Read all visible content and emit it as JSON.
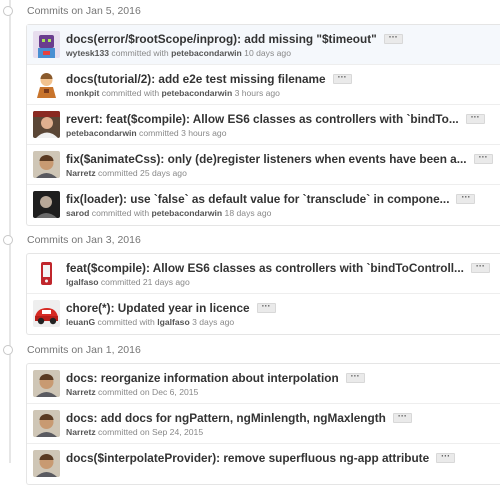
{
  "groups": [
    {
      "date": "Commits on Jan 5, 2016",
      "commits": [
        {
          "message": "docs(error/$rootScope/inprog): add missing \"$timeout\"",
          "author": "wytesk133",
          "connector": " committed with ",
          "committer": "petebacondarwin",
          "time": " 10 days ago",
          "avatar": "robot-avatar-icon"
        },
        {
          "message": "docs(tutorial/2): add e2e test missing filename",
          "author": "monkpit",
          "connector": " committed with ",
          "committer": "petebacondarwin",
          "time": " 3 hours ago",
          "avatar": "monk-avatar-icon"
        },
        {
          "message": "revert: feat($compile): Allow ES6 classes as controllers with `bindTo...",
          "author": "petebacondarwin",
          "connector": "",
          "committer": "",
          "time": " committed 3 hours ago",
          "avatar": "person-avatar-icon"
        },
        {
          "message": "fix($animateCss): only (de)register listeners when events have been a...",
          "author": "Narretz",
          "connector": "",
          "committer": "",
          "time": " committed 25 days ago",
          "avatar": "person-avatar-icon"
        },
        {
          "message": "fix(loader): use `false` as default value for `transclude` in compone...",
          "author": "sarod",
          "connector": " committed with ",
          "committer": "petebacondarwin",
          "time": " 18 days ago",
          "avatar": "person-avatar-icon"
        }
      ]
    },
    {
      "date": "Commits on Jan 3, 2016",
      "commits": [
        {
          "message": "feat($compile): Allow ES6 classes as controllers with `bindToControll...",
          "author": "lgalfaso",
          "connector": "",
          "committer": "",
          "time": " committed 21 days ago",
          "avatar": "phone-avatar-icon"
        },
        {
          "message": "chore(*): Updated year in licence",
          "author": "leuanG",
          "connector": " committed with ",
          "committer": "lgalfaso",
          "time": " 3 days ago",
          "avatar": "car-avatar-icon"
        }
      ]
    },
    {
      "date": "Commits on Jan 1, 2016",
      "commits": [
        {
          "message": "docs: reorganize information about interpolation",
          "author": "Narretz",
          "connector": "",
          "committer": "",
          "time": " committed on Dec 6, 2015",
          "avatar": "person-avatar-icon"
        },
        {
          "message": "docs: add docs for ngPattern, ngMinlength, ngMaxlength",
          "author": "Narretz",
          "connector": "",
          "committer": "",
          "time": " committed on Sep 24, 2015",
          "avatar": "person-avatar-icon"
        },
        {
          "message": "docs($interpolateProvider): remove superfluous ng-app attribute",
          "author": "",
          "connector": "",
          "committer": "",
          "time": "",
          "avatar": "person-avatar-icon"
        }
      ]
    }
  ],
  "ellipsis_label": "···",
  "colors": {
    "link_bold": "#333333",
    "meta": "#888888",
    "timeline": "#e6e6e6",
    "highlight_row": "#f5f8fc"
  }
}
